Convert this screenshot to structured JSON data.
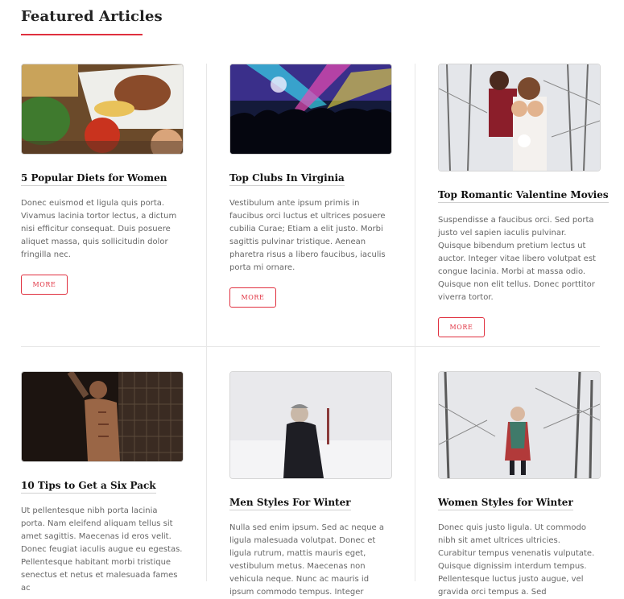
{
  "section": {
    "title": "Featured Articles"
  },
  "colors": {
    "accent": "#e0303f",
    "divider": "#e7e7e7"
  },
  "articles": [
    {
      "title": "5 Popular Diets for Women",
      "excerpt": "Donec euismod et ligula quis porta. Vivamus lacinia tortor lectus, a dictum nisi efficitur consequat. Duis posuere aliquet massa, quis sollicitudin dolor fringilla nec.",
      "button": "MORE",
      "image": "food-photo"
    },
    {
      "title": "Top Clubs In Virginia",
      "excerpt": "Vestibulum ante ipsum primis in faucibus orci luctus et ultrices posuere cubilia Curae; Etiam a elit justo. Morbi sagittis pulvinar tristique. Aenean pharetra risus a libero faucibus, iaculis porta mi ornare.",
      "button": "MORE",
      "image": "nightclub-photo"
    },
    {
      "title": "Top Romantic Valentine Movies",
      "excerpt": "Suspendisse a faucibus orci. Sed porta justo vel sapien iaculis pulvinar. Quisque bibendum pretium lectus ut auctor. Integer vitae libero volutpat est congue lacinia. Morbi at massa odio. Quisque non elit tellus. Donec porttitor viverra tortor.",
      "button": "MORE",
      "image": "couple-snow-photo"
    },
    {
      "title": "10 Tips to Get a Six Pack",
      "excerpt": "Ut pellentesque nibh porta lacinia porta. Nam eleifend aliquam tellus sit amet sagittis. Maecenas id eros velit. Donec feugiat iaculis augue eu egestas. Pellentesque habitant morbi tristique senectus et netus et malesuada fames ac",
      "image": "fitness-man-photo"
    },
    {
      "title": "Men Styles For Winter",
      "excerpt": "Nulla sed enim ipsum. Sed ac neque a ligula malesuada volutpat. Donec et ligula rutrum, mattis mauris eget, vestibulum metus. Maecenas non vehicula neque. Nunc ac mauris id ipsum commodo tempus. Integer",
      "image": "man-winter-photo"
    },
    {
      "title": "Women Styles for Winter",
      "excerpt": "Donec quis justo ligula. Ut commodo nibh sit amet ultrices ultricies. Curabitur tempus venenatis vulputate. Quisque dignissim interdum tempus. Pellentesque luctus justo augue, vel gravida orci tempus a. Sed",
      "image": "woman-winter-photo"
    }
  ]
}
